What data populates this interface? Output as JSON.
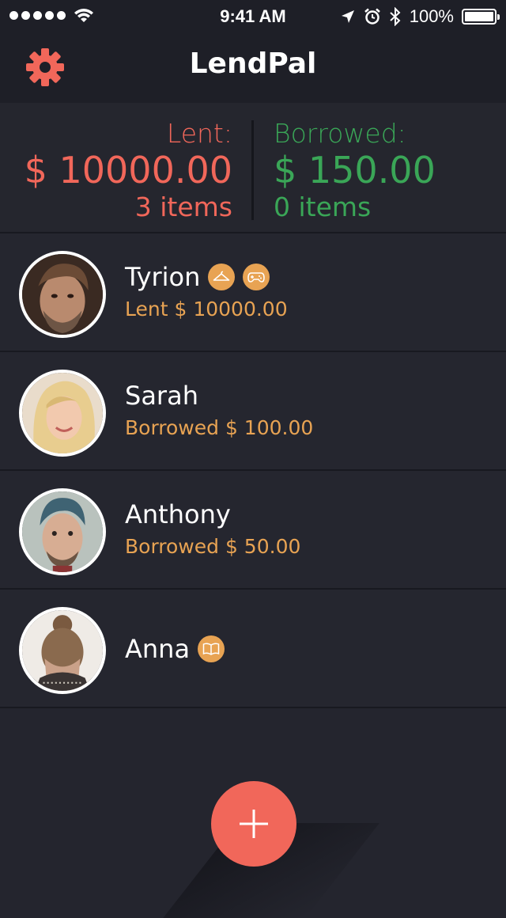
{
  "status_bar": {
    "time": "9:41 AM",
    "battery": "100%",
    "battery_level": 1.0,
    "signal_bars": 5,
    "icons": [
      "signal-dots-icon",
      "wifi-icon",
      "location-arrow-icon",
      "alarm-icon",
      "bluetooth-icon",
      "battery-icon"
    ]
  },
  "nav": {
    "title": "LendPal",
    "settings_icon": "gear-icon"
  },
  "summary": {
    "lent": {
      "label": "Lent:",
      "amount": "$ 10000.00",
      "items": "3 items"
    },
    "borrowed": {
      "label": "Borrowed:",
      "amount": "$ 150.00",
      "items": "0 items"
    }
  },
  "people": [
    {
      "name": "Tyrion",
      "detail": "Lent $ 10000.00",
      "badges": [
        "hanger-icon",
        "gamepad-icon"
      ]
    },
    {
      "name": "Sarah",
      "detail": "Borrowed $ 100.00",
      "badges": []
    },
    {
      "name": "Anthony",
      "detail": "Borrowed $ 50.00",
      "badges": []
    },
    {
      "name": "Anna",
      "detail": "",
      "badges": [
        "book-icon"
      ]
    }
  ],
  "fab": {
    "icon": "plus-icon"
  },
  "colors": {
    "background": "#24252e",
    "lent": "#f1675a",
    "borrowed": "#3aa657",
    "accent": "#e8a353",
    "fab": "#f1675a"
  }
}
